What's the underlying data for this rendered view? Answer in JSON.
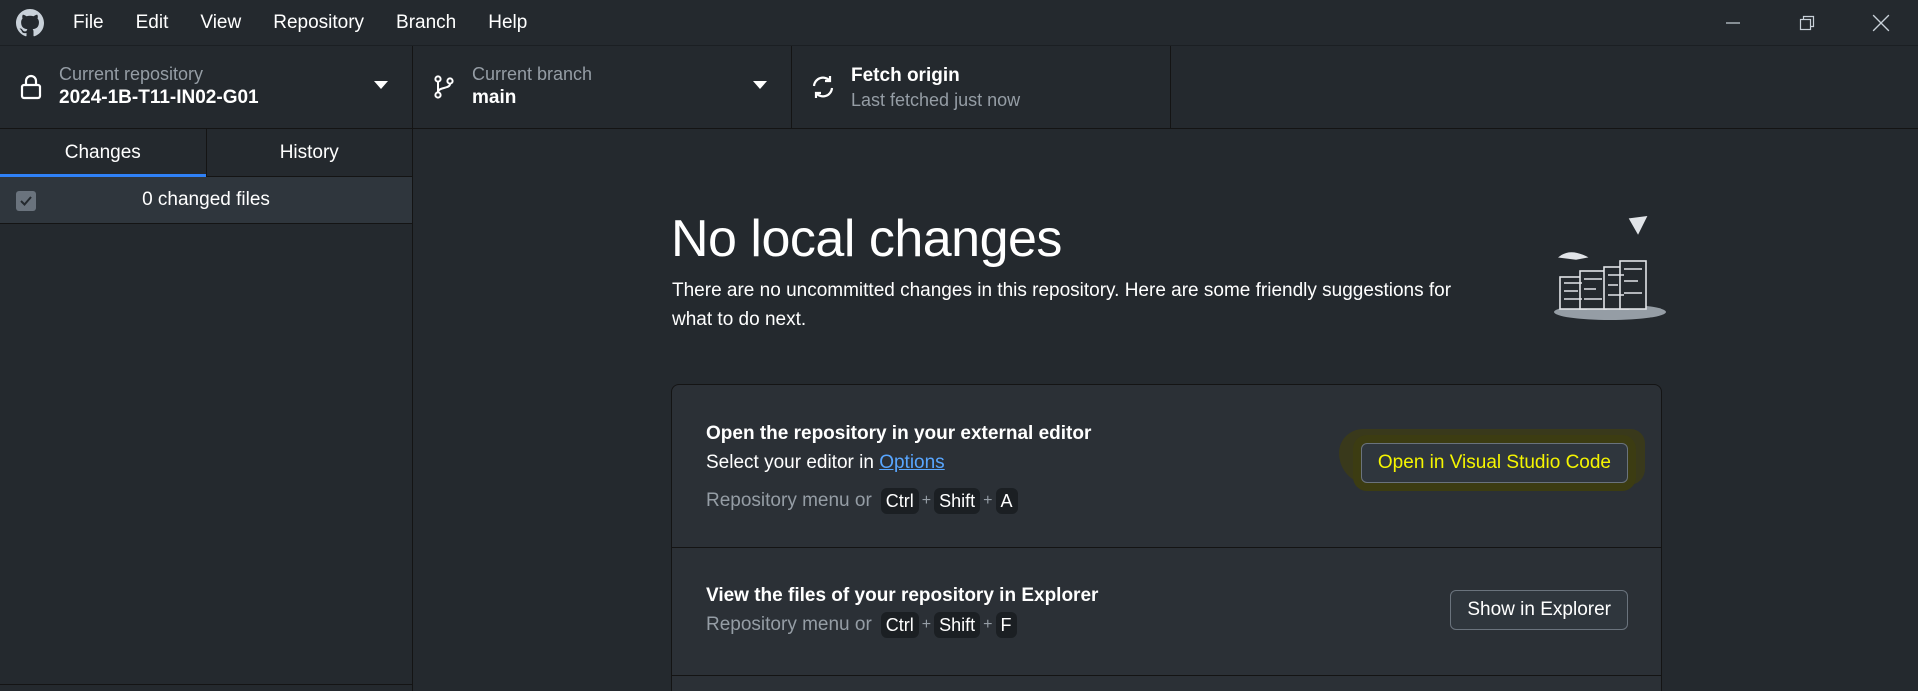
{
  "menu": {
    "items": [
      "File",
      "Edit",
      "View",
      "Repository",
      "Branch",
      "Help"
    ]
  },
  "toolbar": {
    "repository": {
      "label": "Current repository",
      "value": "2024-1B-T11-IN02-G01"
    },
    "branch": {
      "label": "Current branch",
      "value": "main"
    },
    "fetch": {
      "label": "Fetch origin",
      "value": "Last fetched just now"
    }
  },
  "sidebar": {
    "tabs": [
      {
        "label": "Changes",
        "active": true
      },
      {
        "label": "History",
        "active": false
      }
    ],
    "changed_files": "0 changed files"
  },
  "main": {
    "heading": "No local changes",
    "subtext": "There are no uncommitted changes in this repository. Here are some friendly suggestions for what to do next.",
    "suggestions": [
      {
        "title": "Open the repository in your external editor",
        "desc_prefix": "Select your editor in ",
        "desc_link": "Options",
        "shortcut_prefix": "Repository menu or",
        "keys": [
          "Ctrl",
          "Shift",
          "A"
        ],
        "button": "Open in Visual Studio Code"
      },
      {
        "title": "View the files of your repository in Explorer",
        "shortcut_prefix": "Repository menu or",
        "keys": [
          "Ctrl",
          "Shift",
          "F"
        ],
        "button": "Show in Explorer"
      }
    ]
  },
  "colors": {
    "background": "#24292e",
    "accent": "#2f81f7",
    "link": "#58a6ff",
    "highlight_text": "#f5f500"
  }
}
